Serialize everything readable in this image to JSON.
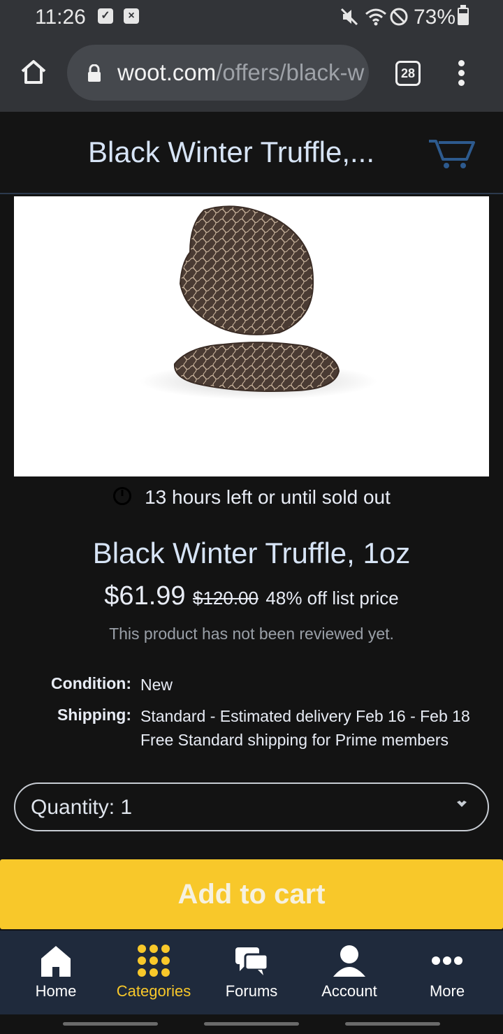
{
  "status_bar": {
    "time": "11:26",
    "battery": "73%",
    "icons": [
      "check-box-icon",
      "close-box-icon",
      "mute-icon",
      "wifi-icon",
      "do-not-disturb-icon",
      "battery-icon"
    ]
  },
  "browser": {
    "url_host": "woot.com",
    "url_path": "/offers/black-w",
    "tab_count": "28"
  },
  "header": {
    "title": "Black Winter Truffle,..."
  },
  "product": {
    "time_left": "13 hours left or until sold out",
    "title": "Black Winter Truffle, 1oz",
    "price": "$61.99",
    "list_price": "$120.00",
    "discount": "48% off list price",
    "reviews": "This product has not been reviewed yet.",
    "condition_label": "Condition:",
    "condition_value": "New",
    "shipping_label": "Shipping:",
    "shipping_line1": "Standard - Estimated delivery Feb 16 - Feb 18",
    "shipping_line2": "Free Standard shipping for Prime members"
  },
  "quantity": {
    "label": "Quantity: 1"
  },
  "add_to_cart": {
    "label": "Add to cart"
  },
  "bottom_nav": [
    {
      "label": "Home",
      "icon": "home-icon"
    },
    {
      "label": "Categories",
      "icon": "grid-dots-icon",
      "active": true
    },
    {
      "label": "Forums",
      "icon": "chat-bubbles-icon"
    },
    {
      "label": "Account",
      "icon": "user-icon"
    },
    {
      "label": "More",
      "icon": "more-dots-icon"
    }
  ],
  "colors": {
    "accent_yellow": "#f8c82a",
    "nav_background": "#1f2a3c",
    "page_background": "#131313",
    "title_blue": "#d7e4f6"
  }
}
